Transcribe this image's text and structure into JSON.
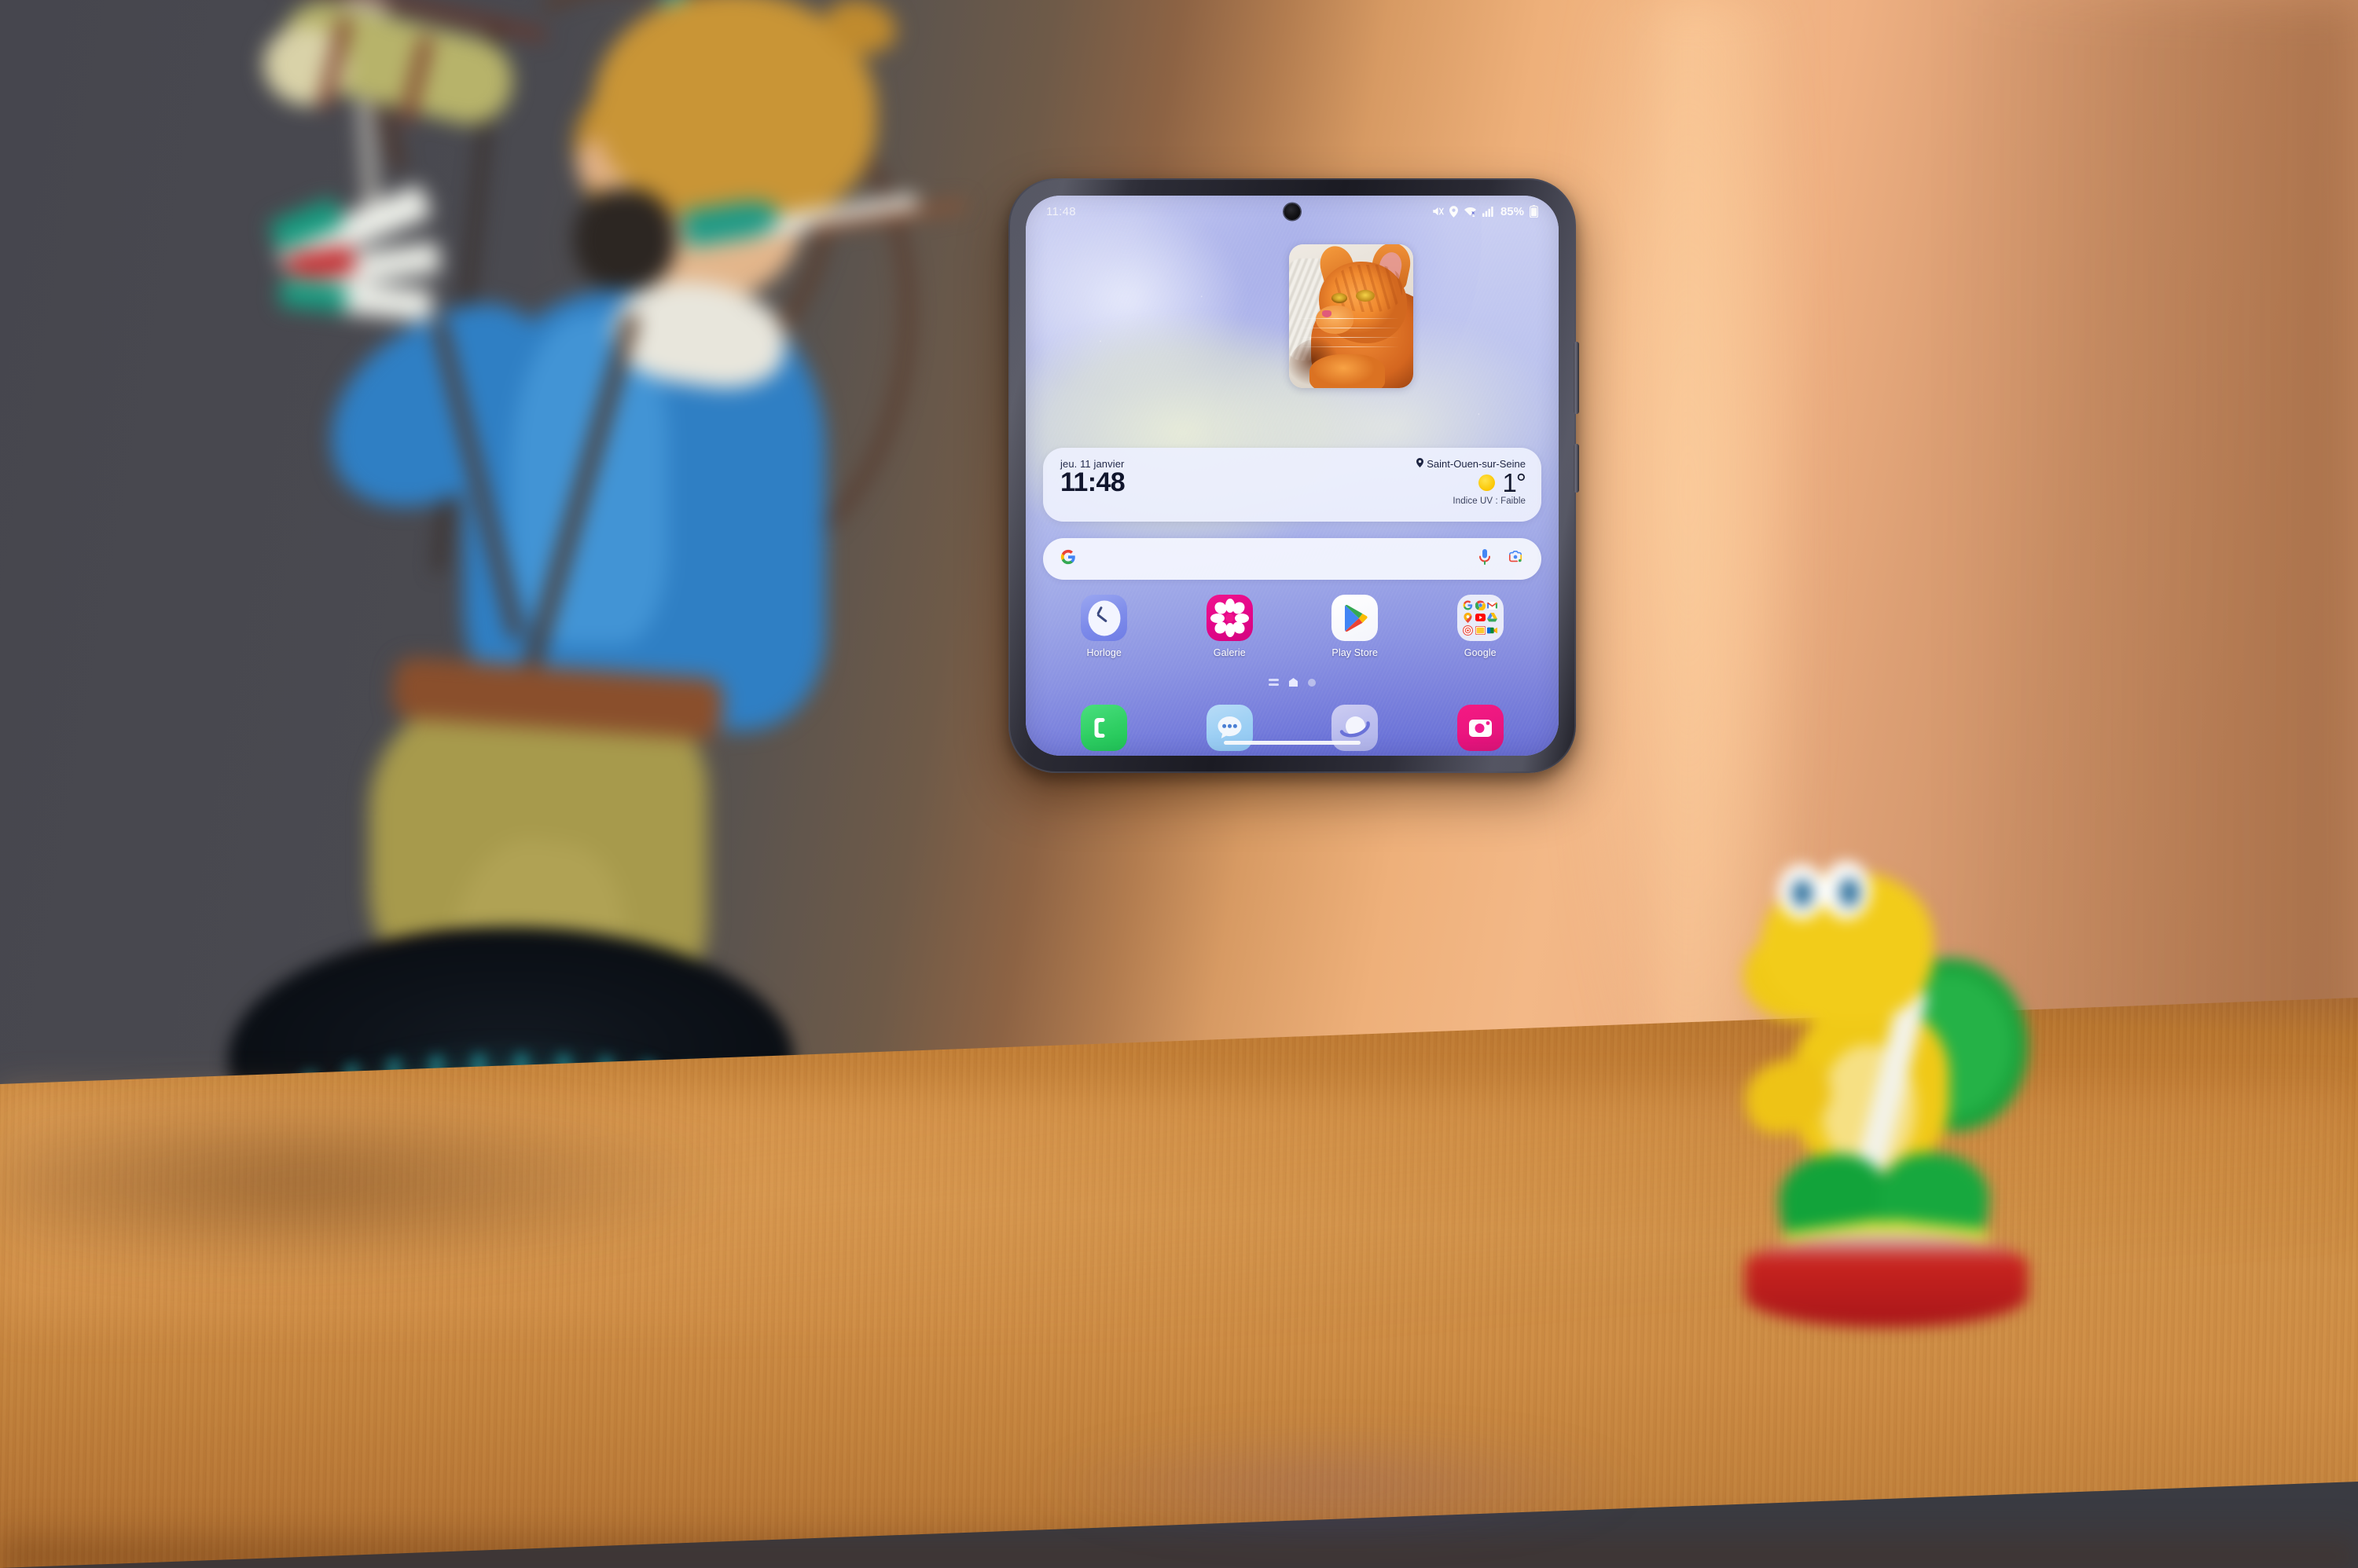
{
  "scene": {
    "description": "photo-of-phone-on-wooden-desk",
    "objects": [
      {
        "name": "link-figurine",
        "label": "Link archer figurine (blurred background)"
      },
      {
        "name": "koopa-figurine",
        "label": "Koopa Troopa amiibo figurine (blurred background)"
      },
      {
        "name": "wooden-desk",
        "label": "Wooden desk surface"
      },
      {
        "name": "wall",
        "label": "Gray and warm orange wall"
      }
    ]
  },
  "phone": {
    "status_bar": {
      "time": "11:48",
      "battery_percent": "85%",
      "icons": [
        "mute-icon",
        "location-icon",
        "wifi-icon",
        "signal-icon",
        "battery-icon"
      ]
    },
    "photo_widget": {
      "name": "photo-widget",
      "alt": "Orange tabby cat on white knit blanket"
    },
    "clock_widget": {
      "date": "jeu. 11 janvier",
      "location": "Saint-Ouen-sur-Seine",
      "time": "11:48",
      "temperature": "1°",
      "uv_index": "Indice UV : Faible",
      "weather_icon": "sun-icon",
      "location_icon": "pin-icon"
    },
    "search_bar": {
      "placeholder": "",
      "value": "",
      "brand_icon": "google-g-icon",
      "mic_icon": "microphone-icon",
      "lens_icon": "google-lens-icon"
    },
    "apps": [
      {
        "label": "Horloge",
        "icon": "clock-app-icon"
      },
      {
        "label": "Galerie",
        "icon": "gallery-app-icon"
      },
      {
        "label": "Play Store",
        "icon": "play-store-app-icon"
      },
      {
        "label": "Google",
        "icon": "google-folder-icon"
      }
    ],
    "google_folder_apps": [
      {
        "name": "google-search-mini-icon"
      },
      {
        "name": "chrome-mini-icon"
      },
      {
        "name": "gmail-mini-icon"
      },
      {
        "name": "maps-mini-icon"
      },
      {
        "name": "youtube-mini-icon"
      },
      {
        "name": "drive-mini-icon"
      },
      {
        "name": "photos-mini-icon"
      },
      {
        "name": "google-tv-mini-icon"
      },
      {
        "name": "meet-mini-icon"
      }
    ],
    "page_indicator": {
      "items": [
        "apps-page-icon",
        "home-page-icon",
        "widgets-page-dot"
      ],
      "active_index": 1
    },
    "dock": [
      {
        "name": "phone-dock-icon"
      },
      {
        "name": "messages-dock-icon"
      },
      {
        "name": "internet-dock-icon"
      },
      {
        "name": "camera-dock-icon"
      }
    ],
    "gesture_bar": {
      "name": "gesture-navigation-bar"
    }
  },
  "colors": {
    "wallpaper_top": "#cfd3f4",
    "wallpaper_bottom": "#5d64d4",
    "widget_bg": "#ecf0fd",
    "gallery_pink": "#f0148c",
    "phone_green": "#2fcf63",
    "camera_pink": "#f5127f",
    "messages_blue": "#9ccff4",
    "text_dark": "#10152c",
    "wall_orange": "#f3b887",
    "wall_gray": "#46464e",
    "desk_wood": "#cf9047"
  }
}
